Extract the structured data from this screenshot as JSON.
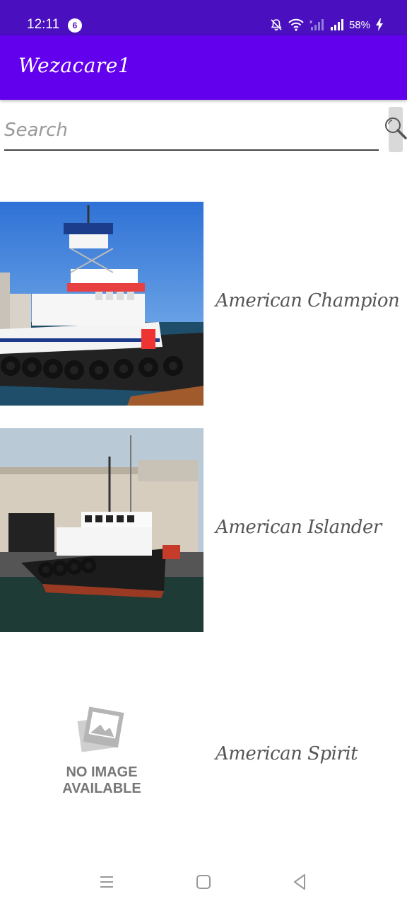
{
  "status_bar": {
    "time": "12:11",
    "notification_count": "6",
    "battery": "58%"
  },
  "app_bar": {
    "title": "Wezacare1"
  },
  "search": {
    "placeholder": "Search",
    "value": ""
  },
  "ships": [
    {
      "name": "American Champion",
      "image": "tugboat-photo"
    },
    {
      "name": "American Islander",
      "image": "tugboat-photo"
    },
    {
      "name": "American Spirit",
      "image": "no-image-placeholder",
      "no_image_line1": "NO IMAGE",
      "no_image_line2": "AVAILABLE"
    }
  ],
  "colors": {
    "status_bar": "#4a0fbf",
    "app_bar": "#6200ee",
    "text": "#555555"
  }
}
